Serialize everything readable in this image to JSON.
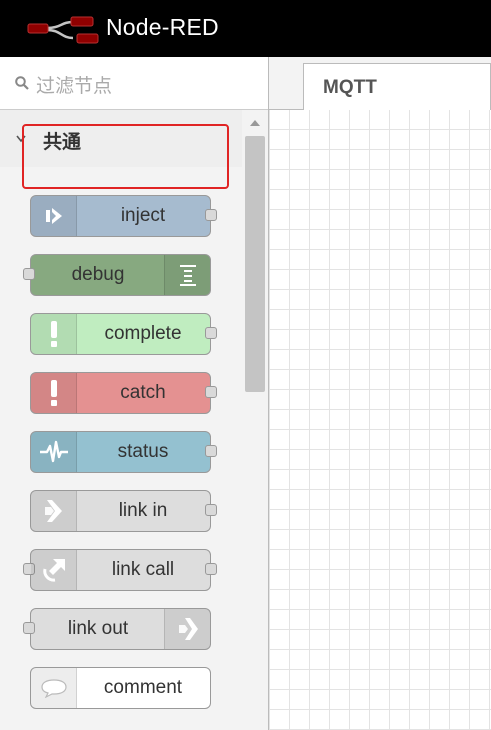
{
  "app": {
    "title": "Node-RED"
  },
  "palette": {
    "filter_placeholder": "过滤节点",
    "category": "共通",
    "nodes": [
      {
        "label": "inject",
        "color": "#a6bbcf",
        "icon": "inject-arrow-icon"
      },
      {
        "label": "debug",
        "color": "#87a980",
        "icon": "debug-list-icon"
      },
      {
        "label": "complete",
        "color": "#c0edc0",
        "icon": "exclamation-icon"
      },
      {
        "label": "catch",
        "color": "#e49191",
        "icon": "exclamation-icon"
      },
      {
        "label": "status",
        "color": "#94c1d0",
        "icon": "pulse-wave-icon"
      },
      {
        "label": "link in",
        "color": "#dddddd",
        "icon": "link-in-icon"
      },
      {
        "label": "link call",
        "color": "#dddddd",
        "icon": "link-call-icon"
      },
      {
        "label": "link out",
        "color": "#dddddd",
        "icon": "link-out-icon"
      },
      {
        "label": "comment",
        "color": "#ffffff",
        "icon": "speech-bubble-icon"
      }
    ]
  },
  "workspace": {
    "tabs": [
      {
        "label": "MQTT"
      }
    ]
  }
}
